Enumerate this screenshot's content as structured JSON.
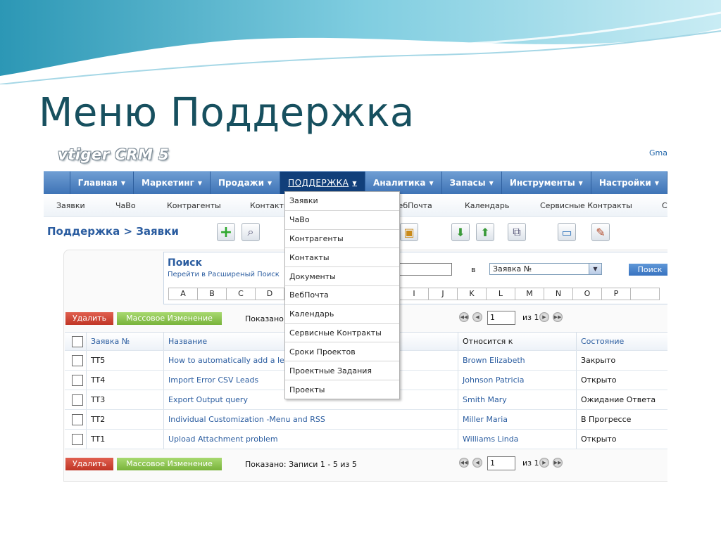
{
  "slide": {
    "title": "Меню Поддержка"
  },
  "app": {
    "logo": "vtiger CRM 5",
    "user_link": "Gma"
  },
  "main_nav": [
    {
      "label": "Главная"
    },
    {
      "label": "Маркетинг"
    },
    {
      "label": "Продажи"
    },
    {
      "label": "ПОДДЕРЖКА",
      "active": true
    },
    {
      "label": "Аналитика"
    },
    {
      "label": "Запасы"
    },
    {
      "label": "Инструменты"
    },
    {
      "label": "Настройки"
    }
  ],
  "sub_nav": [
    "Заявки",
    "ЧаВо",
    "Контрагенты",
    "Контакты",
    "ВебПочта",
    "Календарь",
    "Сервисные Контракты",
    "С"
  ],
  "breadcrumb": "Поддержка > Заявки",
  "search": {
    "title": "Поиск",
    "advanced_link": "Перейти в Расширеный Поиск",
    "in_label": "в",
    "field_value": "Заявка №",
    "button": "Поиск",
    "letters": [
      "A",
      "B",
      "C",
      "D",
      "I",
      "J",
      "K",
      "L",
      "M",
      "N",
      "O",
      "P"
    ]
  },
  "actions": {
    "delete": "Удалить",
    "mass_edit": "Массовое Изменение",
    "shown_top": "Показано:",
    "shown_bottom": "Показано: Записи 1 - 5 из 5"
  },
  "pager": {
    "page": "1",
    "of": "из 1"
  },
  "table": {
    "headers": {
      "ticket": "Заявка №",
      "title": "Название",
      "related": "Относится к",
      "status": "Состояние"
    },
    "rows": [
      {
        "ticket": "TT5",
        "title": "How to automatically add a le",
        "related": "Brown Elizabeth",
        "status": "Закрыто"
      },
      {
        "ticket": "TT4",
        "title": "Import Error CSV Leads",
        "related": "Johnson Patricia",
        "status": "Открыто"
      },
      {
        "ticket": "TT3",
        "title": "Export Output query",
        "related": "Smith Mary",
        "status": "Ожидание Ответа"
      },
      {
        "ticket": "TT2",
        "title": "Individual Customization -Menu and RSS",
        "related": "Miller Maria",
        "status": "В Прогрессе"
      },
      {
        "ticket": "TT1",
        "title": "Upload Attachment problem",
        "related": "Williams Linda",
        "status": "Открыто"
      }
    ]
  },
  "dropdown": [
    "Заявки",
    "ЧаВо",
    "Контрагенты",
    "Контакты",
    "Документы",
    "ВебПочта",
    "Календарь",
    "Сервисные Контракты",
    "Сроки Проектов",
    "Проектные Задания",
    "Проекты"
  ],
  "icons": {
    "create": "plus-icon",
    "search": "search-icon",
    "import": "import-icon",
    "export": "export-icon",
    "dedupe": "find-duplicates-icon",
    "settings": "settings-icon",
    "tools": "tools-icon"
  },
  "colors": {
    "title": "#17505f",
    "nav": "#4a80c0",
    "nav_active": "#113f7a",
    "link": "#2b5da0",
    "delete": "#cd4233",
    "mass_edit": "#8cc453"
  }
}
